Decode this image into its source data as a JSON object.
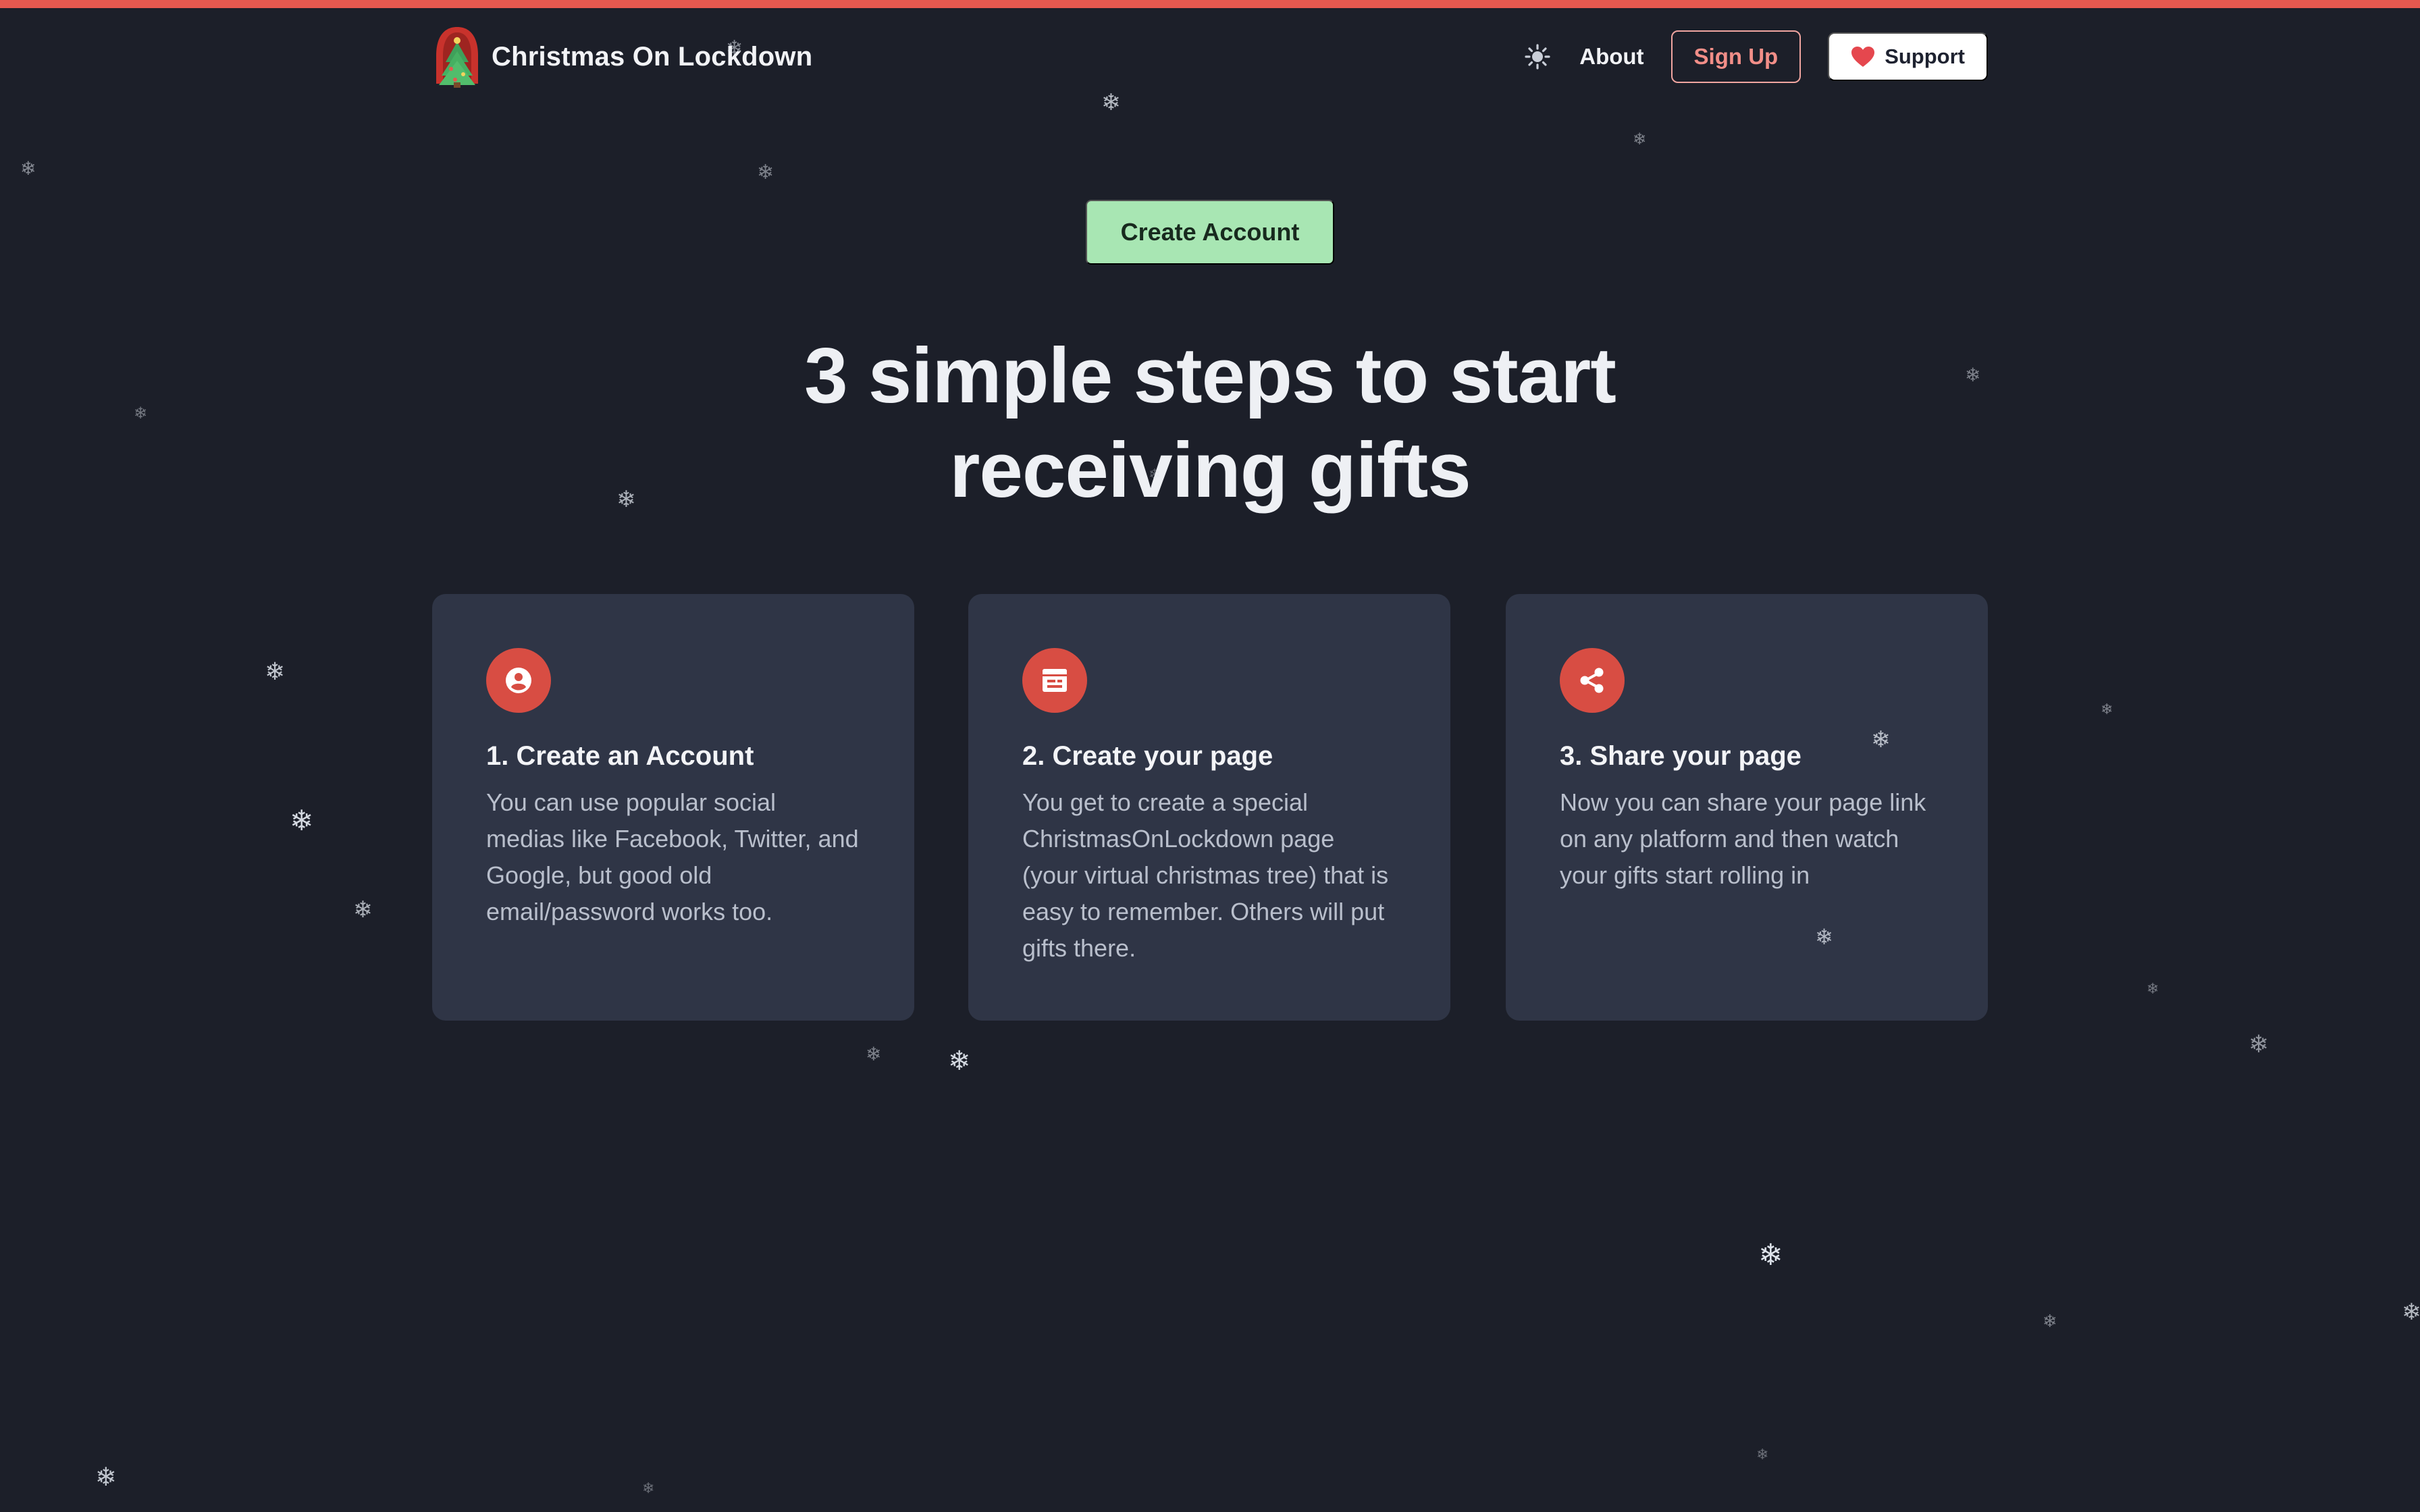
{
  "brand": {
    "name": "Christmas On Lockdown",
    "logo_icon": "christmas-tree-logo"
  },
  "nav": {
    "theme_icon": "sun-icon",
    "about": "About",
    "signup": "Sign Up",
    "support": "Support",
    "support_icon": "heart-icon"
  },
  "hero": {
    "cta": "Create Account",
    "headline_line1": "3 simple steps to start",
    "headline_line2": "receiving gifts"
  },
  "steps": [
    {
      "icon": "user-circle-icon",
      "title": "1. Create an Account",
      "description": "You can use popular social medias like Facebook, Twitter, and Google, but good old email/password works too."
    },
    {
      "icon": "page-icon",
      "title": "2. Create your page",
      "description": "You get to create a special ChristmasOnLockdown page (your virtual christmas tree) that is easy to remember. Others will put gifts there."
    },
    {
      "icon": "share-icon",
      "title": "3. Share your page",
      "description": "Now you can share your page link on any platform and then watch your gifts start rolling in"
    }
  ],
  "colors": {
    "background": "#1c1f29",
    "top_accent": "#e5584f",
    "card": "#2f3546",
    "cta": "#a8e6b3",
    "icon_circle": "#d84d43",
    "signup_text": "#f28e88"
  },
  "decor": {
    "flake_glyph": "❄"
  }
}
